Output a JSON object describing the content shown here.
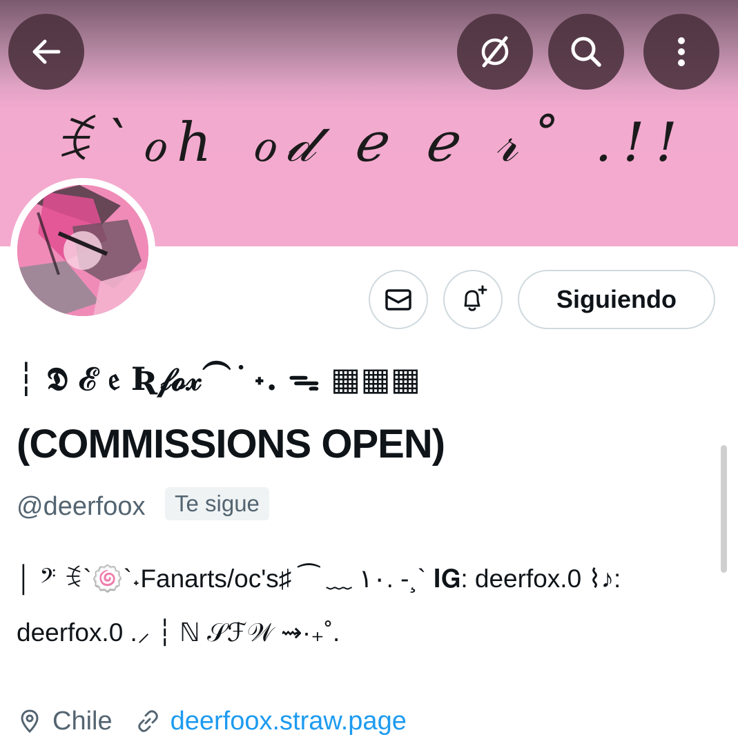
{
  "banner": {
    "text": "ꉂ`ℴℎ ℴ𝒹 ℯ ℯ 𝓇˚ .!!"
  },
  "header": {
    "back_icon": "arrow-left-icon",
    "grok_icon": "grok-icon",
    "search_icon": "search-icon",
    "more_icon": "more-vertical-icon"
  },
  "profile": {
    "display_name_line1": "┆ 𝕯 ℰ 𝔢 Ʀ𝒻𝓸𝓍⁀ ͘ ˖. ᯓ  ▦▦▦",
    "display_name_line2": "(COMMISSIONS OPEN)",
    "handle": "@deerfoox",
    "follows_you": "Te sigue",
    "bio_line1": "│ 𝄢 ꉂ`🍥`˖Fanarts/oc's♯ ⁀ ﹏ ١٠. -¸` 𝐈𝐆: deerfox.0 ⌇♪:",
    "bio_line2": "deerfox.0 .⸝ ┆ ℕ 𝒮ℱ𝒲 ⇝·₊˚.",
    "location": "Chile",
    "website": "deerfoox.straw.page"
  },
  "actions": {
    "message_icon": "mail-icon",
    "notify_icon": "bell-plus-icon",
    "following_label": "Siguiendo"
  },
  "colors": {
    "banner_pink": "#f4aace",
    "link_blue": "#1d9bf0",
    "secondary_text": "#536471",
    "button_border": "#cfd9de"
  }
}
